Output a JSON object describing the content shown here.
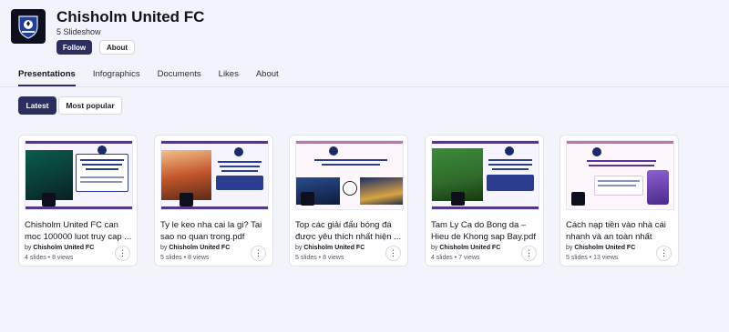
{
  "profile": {
    "name": "Chisholm United FC",
    "subtitle": "5 Slideshow",
    "follow_label": "Follow",
    "about_label": "About"
  },
  "tabs": [
    {
      "label": "Presentations",
      "active": true
    },
    {
      "label": "Infographics",
      "active": false
    },
    {
      "label": "Documents",
      "active": false
    },
    {
      "label": "Likes",
      "active": false
    },
    {
      "label": "About",
      "active": false
    }
  ],
  "filters": [
    {
      "label": "Latest",
      "active": true
    },
    {
      "label": "Most popular",
      "active": false
    }
  ],
  "cards": [
    {
      "title": "Chisholm United FC can moc 100000 luot truy cap ...",
      "by": "by",
      "author": "Chisholm United FC",
      "meta": "4 slides • 8 views"
    },
    {
      "title": "Ty le keo nha cai la gi? Tai sao no quan trong.pdf",
      "by": "by",
      "author": "Chisholm United FC",
      "meta": "5 slides • 8 views"
    },
    {
      "title": "Top các giải đấu bóng đá được yêu thích nhất hiện ...",
      "by": "by",
      "author": "Chisholm United FC",
      "meta": "5 slides • 8 views"
    },
    {
      "title": "Tam Ly Ca do Bong da – Hieu de Khong sap Bay.pdf",
      "by": "by",
      "author": "Chisholm United FC",
      "meta": "4 slides • 7 views"
    },
    {
      "title": "Cách nạp tiền vào nhà cái nhanh và an toàn nhất hiện...",
      "by": "by",
      "author": "Chisholm United FC",
      "meta": "5 slides • 13 views"
    }
  ],
  "icons": {
    "avatar": "club-crest-icon",
    "more": "more-vertical-icon"
  },
  "colors": {
    "accent": "#2b2e5f",
    "background": "#f3f4fb",
    "thumb_accent": "#5b2f9c"
  }
}
